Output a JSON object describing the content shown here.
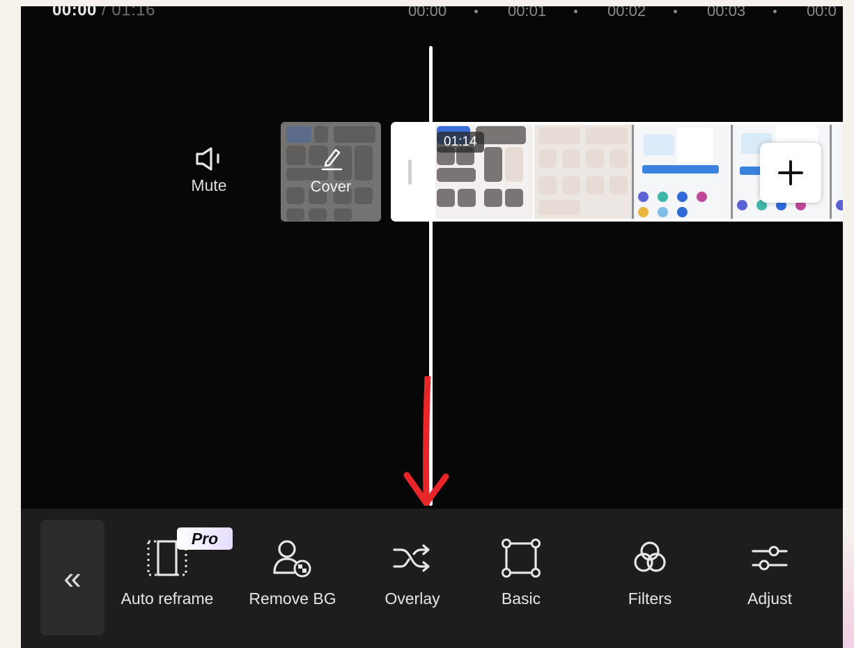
{
  "timeline": {
    "current_time": "00:00",
    "total_time": " / 01:16",
    "ruler_marks": [
      "00:00",
      "00:01",
      "00:02",
      "00:03",
      "00:0"
    ]
  },
  "track": {
    "mute_label": "Mute",
    "cover_label": "Cover",
    "clip_time_badge": "01:14",
    "add_clip_icon": "plus-icon"
  },
  "annotation": {
    "arrow_color": "#e8262a",
    "points_to": "Overlay"
  },
  "toolbar": {
    "collapse_icon": "double-chevron-left-icon",
    "collapse_glyph": "«",
    "pro_badge": "Pro",
    "tools": [
      {
        "label": "Auto reframe",
        "icon": "auto-reframe-icon"
      },
      {
        "label": "Remove BG",
        "icon": "remove-bg-icon"
      },
      {
        "label": "Overlay",
        "icon": "overlay-shuffle-icon"
      },
      {
        "label": "Basic",
        "icon": "basic-square-icon"
      },
      {
        "label": "Filters",
        "icon": "filters-icon"
      },
      {
        "label": "Adjust",
        "icon": "adjust-sliders-icon"
      }
    ]
  },
  "colors": {
    "editor_bg": "#070707",
    "toolbar_bg": "#1d1d1d",
    "page_bg": "#f6f1ea"
  }
}
